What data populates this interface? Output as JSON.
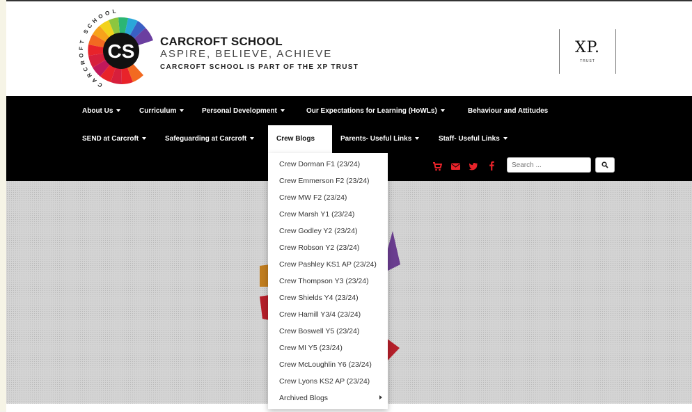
{
  "header": {
    "school_name": "CARCROFT SCHOOL",
    "tagline": "ASPIRE, BELIEVE, ACHIEVE",
    "trust_line": "CARCROFT SCHOOL IS PART OF THE XP TRUST",
    "logo_initials": "CS",
    "logo_ring_text": "CARCROFT SCHOOL",
    "xp_logo_text": "XP.",
    "xp_logo_sub": "TRUST"
  },
  "nav": {
    "row1": [
      {
        "label": "About Us",
        "has_caret": true
      },
      {
        "label": "Curriculum",
        "has_caret": true
      },
      {
        "label": "Personal Development",
        "has_caret": true
      },
      {
        "label": "Our Expectations for Learning (HoWLs)",
        "has_caret": true
      },
      {
        "label": "Behaviour and Attitudes",
        "has_caret": false
      }
    ],
    "row2": [
      {
        "label": "SEND at Carcroft",
        "has_caret": true
      },
      {
        "label": "Safeguarding at Carcroft",
        "has_caret": true
      },
      {
        "label": "Crew Blogs",
        "has_caret": false,
        "active": true
      },
      {
        "label": "Parents- Useful Links",
        "has_caret": true
      },
      {
        "label": "Staff- Useful Links",
        "has_caret": true
      }
    ],
    "icons": [
      "cart-icon",
      "envelope-icon",
      "twitter-icon",
      "facebook-icon"
    ],
    "icon_color": "#e8232a",
    "search": {
      "placeholder": "Search ..."
    }
  },
  "dropdown": {
    "items": [
      "Crew Dorman F1 (23/24)",
      "Crew Emmerson F2 (23/24)",
      "Crew MW F2 (23/24)",
      "Crew Marsh Y1 (23/24)",
      "Crew Godley Y2 (23/24)",
      "Crew Robson Y2 (23/24)",
      "Crew Pashley KS1 AP (23/24)",
      "Crew Thompson Y3 (23/24)",
      "Crew Shields Y4 (23/24)",
      "Crew Hamill Y3/4 (23/24)",
      "Crew Boswell Y5 (23/24)",
      "Crew MI Y5 (23/24)",
      "Crew McLoughlin Y6 (23/24)",
      "Crew Lyons KS2 AP (23/24)",
      "Archived Blogs"
    ]
  }
}
